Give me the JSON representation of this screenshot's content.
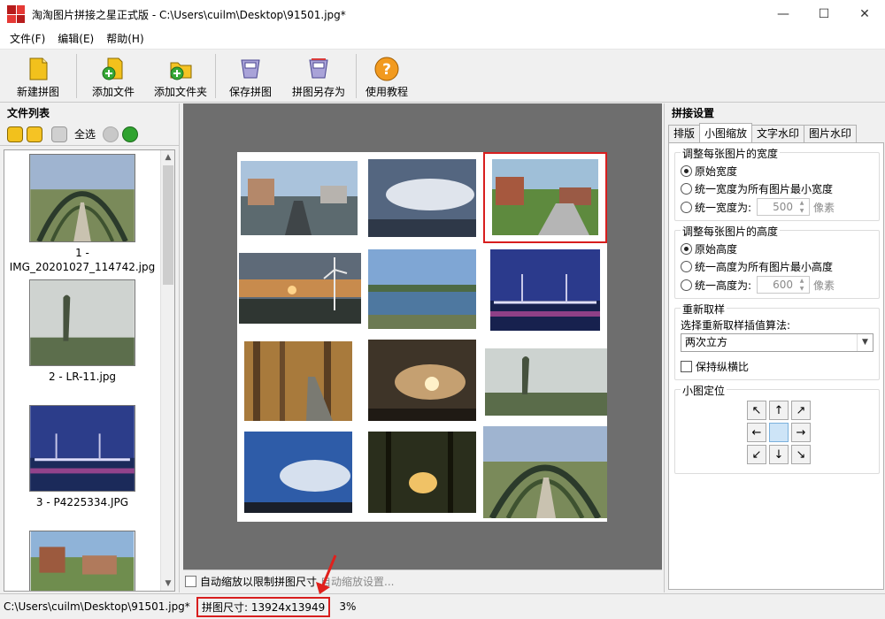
{
  "window": {
    "title": "淘淘图片拼接之星正式版 - C:\\Users\\cuilm\\Desktop\\91501.jpg*",
    "minimize": "—",
    "maximize": "☐",
    "close": "✕"
  },
  "menu": [
    "文件(F)",
    "编辑(E)",
    "帮助(H)"
  ],
  "toolbar": {
    "new": "新建拼图",
    "add_file": "添加文件",
    "add_folder": "添加文件夹",
    "save": "保存拼图",
    "save_as": "拼图另存为",
    "help": "使用教程"
  },
  "file_list": {
    "title": "文件列表",
    "select_all": "全选",
    "items": [
      {
        "label": "1 - IMG_20201027_114742.jpg"
      },
      {
        "label": "2 - LR-11.jpg"
      },
      {
        "label": "3 - P4225334.JPG"
      },
      {
        "label": ""
      }
    ]
  },
  "canvas_bottom": {
    "auto_scale_label": "自动缩放以限制拼图尺寸",
    "auto_scale_settings": "自动缩放设置..."
  },
  "settings": {
    "title": "拼接设置",
    "tabs": [
      "排版",
      "小图缩放",
      "文字水印",
      "图片水印"
    ],
    "active_tab": "小图缩放",
    "width_group": {
      "title": "调整每张图片的宽度",
      "opt1": "原始宽度",
      "opt2": "统一宽度为所有图片最小宽度",
      "opt3": "统一宽度为:",
      "value": "500",
      "unit": "像素"
    },
    "height_group": {
      "title": "调整每张图片的高度",
      "opt1": "原始高度",
      "opt2": "统一高度为所有图片最小高度",
      "opt3": "统一高度为:",
      "value": "600",
      "unit": "像素"
    },
    "resample": {
      "title": "重新取样",
      "algo_label": "选择重新取样插值算法:",
      "algo_value": "两次立方",
      "keep_ratio": "保持纵横比"
    },
    "position": {
      "title": "小图定位",
      "arrows": [
        "↖",
        "↑",
        "↗",
        "←",
        "",
        "→",
        "↙",
        "↓",
        "↘"
      ]
    }
  },
  "status": {
    "path": "C:\\Users\\cuilm\\Desktop\\91501.jpg*",
    "size": "拼图尺寸: 13924x13949",
    "zoom": "3%"
  },
  "colors": {
    "highlight_red": "#d81e1e",
    "canvas_gray": "#6e6e6e"
  }
}
